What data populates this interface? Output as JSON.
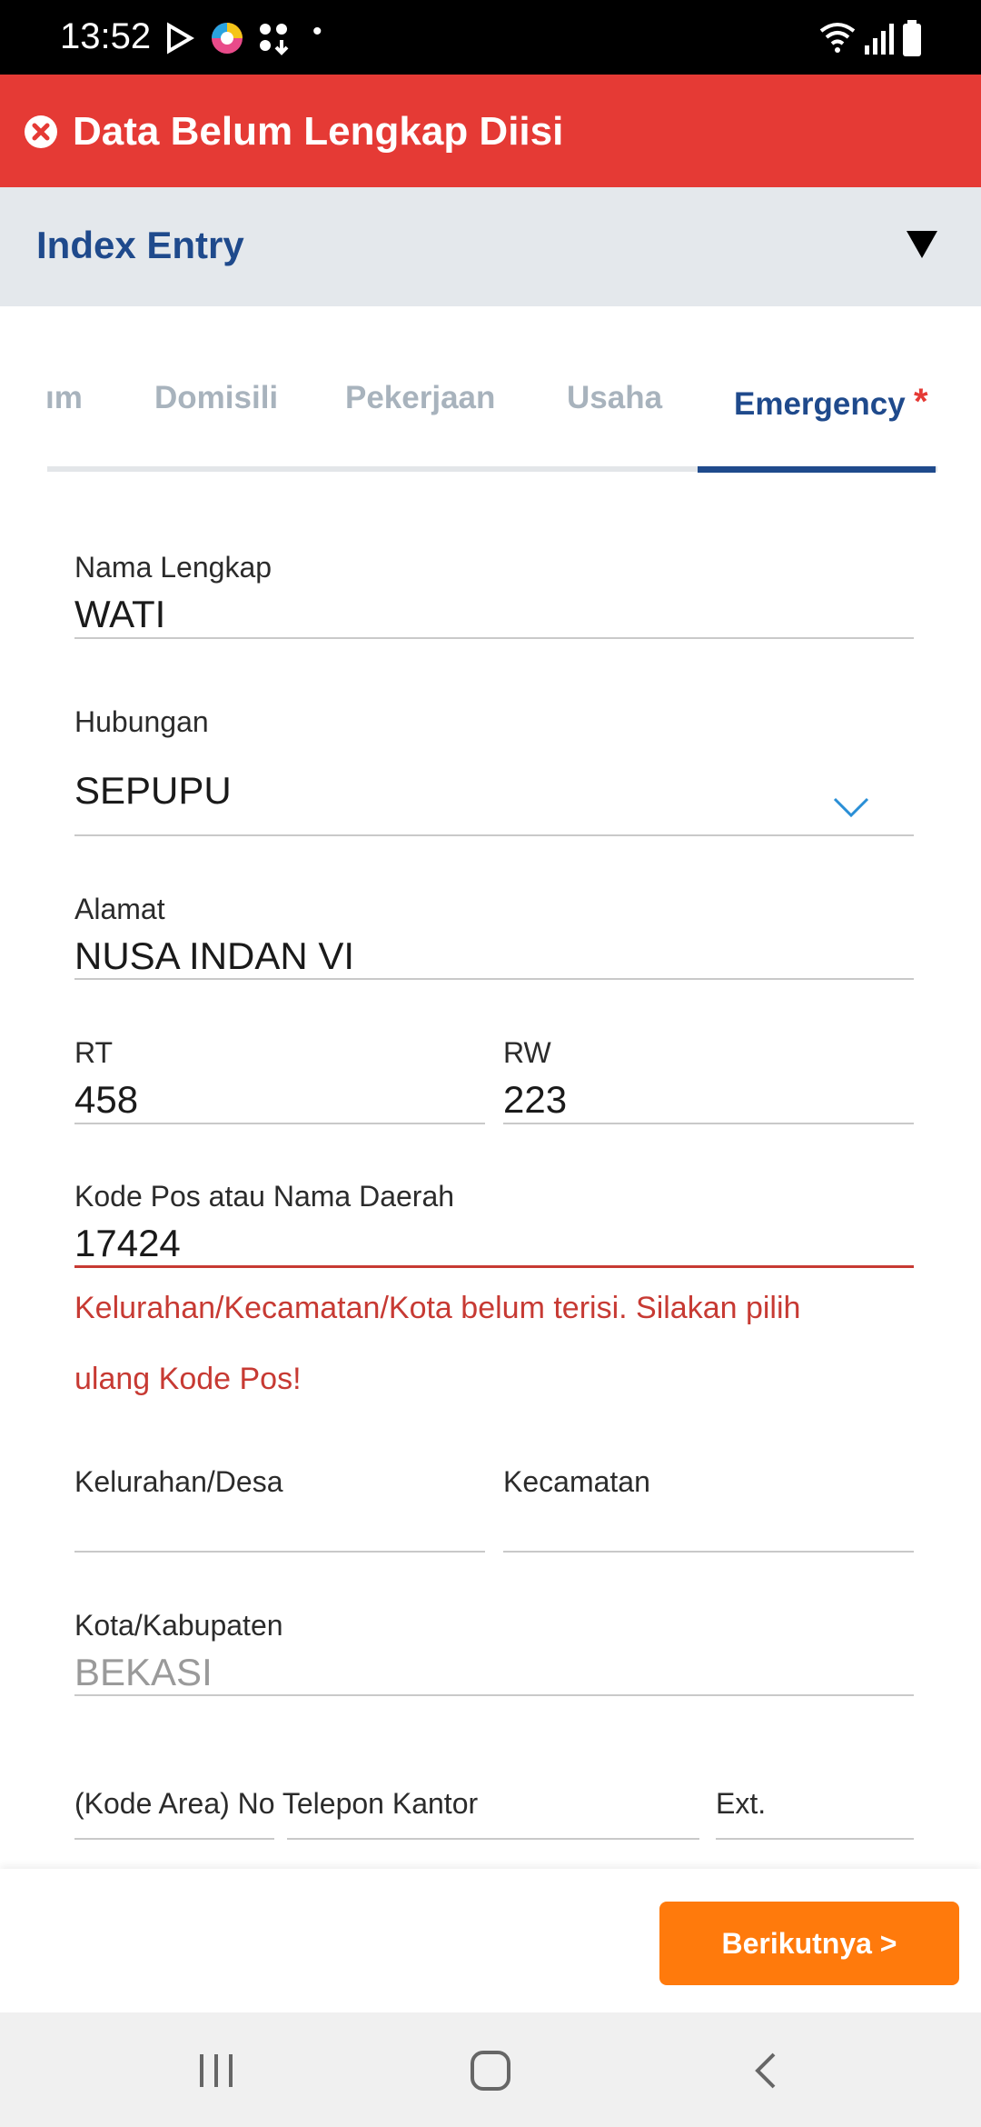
{
  "status_bar": {
    "time": "13:52",
    "dot": "•"
  },
  "banner": {
    "message": "Data Belum Lengkap Diisi",
    "color": "#e53a35"
  },
  "header": {
    "title": "Index Entry"
  },
  "tabs": [
    {
      "label": "ım",
      "active": false
    },
    {
      "label": "Domisili",
      "active": false
    },
    {
      "label": "Pekerjaan",
      "active": false
    },
    {
      "label": "Usaha",
      "active": false
    },
    {
      "label": "Emergency",
      "active": true,
      "required_marker": "*"
    }
  ],
  "form": {
    "nama_lengkap": {
      "label": "Nama Lengkap",
      "value": "WATI"
    },
    "hubungan": {
      "label": "Hubungan",
      "value": "SEPUPU"
    },
    "alamat": {
      "label": "Alamat",
      "value": "NUSA INDAN VI"
    },
    "rt": {
      "label": "RT",
      "value": "458"
    },
    "rw": {
      "label": "RW",
      "value": "223"
    },
    "kode_pos": {
      "label": "Kode Pos atau Nama Daerah",
      "value": "17424",
      "error_line1": "Kelurahan/Kecamatan/Kota belum terisi. Silakan pilih",
      "error_line2": "ulang Kode Pos!"
    },
    "kelurahan": {
      "label": "Kelurahan/Desa",
      "value": ""
    },
    "kecamatan": {
      "label": "Kecamatan",
      "value": ""
    },
    "kota": {
      "label": "Kota/Kabupaten",
      "value": "BEKASI"
    },
    "telepon_kantor": {
      "label": "(Kode Area) No Telepon Kantor",
      "ext_label": "Ext."
    }
  },
  "actions": {
    "next_label": "Berikutnya >"
  },
  "colors": {
    "brand_blue": "#1f4a8c",
    "error_red": "#c73a33",
    "accent_orange": "#ff7a0c"
  }
}
